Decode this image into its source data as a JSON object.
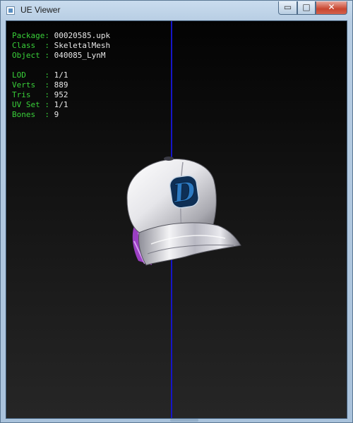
{
  "window": {
    "title": "UE Viewer"
  },
  "controls": {
    "minimize": "▭",
    "maximize": "□",
    "close": "✕"
  },
  "info": {
    "package_key": "Package: ",
    "package": "00020585.upk",
    "class_key": "Class  : ",
    "class": "SkeletalMesh",
    "object_key": "Object : ",
    "object": "040085_LynM",
    "lod_key": "LOD    : ",
    "lod": "1/1",
    "verts_key": "Verts  : ",
    "verts": "889",
    "tris_key": "Tris   : ",
    "tris": "952",
    "uvset_key": "UV Set : ",
    "uvset": "1/1",
    "bones_key": "Bones  : ",
    "bones": "9"
  },
  "model": {
    "logo_letter": "D"
  },
  "colors": {
    "axis": "#1515c8",
    "label": "#39d039",
    "value": "#e8e8e8",
    "logo": "#1f5fa0"
  }
}
